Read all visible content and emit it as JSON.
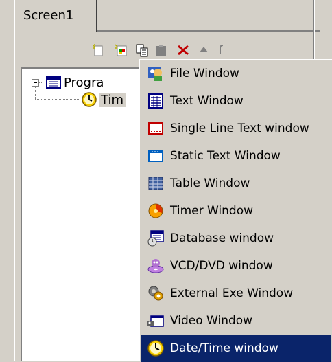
{
  "tabs": [
    {
      "label": "Screen1"
    }
  ],
  "toolbar": {
    "buttons": [
      {
        "icon": "new-item-icon"
      },
      {
        "icon": "add-window-icon"
      },
      {
        "icon": "copy-icon"
      },
      {
        "icon": "paste-icon"
      },
      {
        "icon": "delete-icon"
      },
      {
        "icon": "move-up-icon"
      },
      {
        "icon": "move-down-icon"
      }
    ]
  },
  "tree": {
    "root": {
      "label": "Progra",
      "expanded": true,
      "icon": "program-icon"
    },
    "children": [
      {
        "label": "Tim",
        "icon": "clock-icon",
        "selected": true
      }
    ]
  },
  "menu": {
    "items": [
      {
        "label": "File Window",
        "icon": "file-window-icon"
      },
      {
        "label": "Text Window",
        "icon": "text-window-icon"
      },
      {
        "label": "Single Line Text window",
        "icon": "single-line-text-icon"
      },
      {
        "label": "Static Text Window",
        "icon": "static-text-icon"
      },
      {
        "label": "Table Window",
        "icon": "table-window-icon"
      },
      {
        "label": "Timer Window",
        "icon": "timer-icon"
      },
      {
        "label": "Database window",
        "icon": "database-icon"
      },
      {
        "label": "VCD/DVD window",
        "icon": "vcd-dvd-icon"
      },
      {
        "label": "External Exe Window",
        "icon": "external-exe-icon"
      },
      {
        "label": "Video Window",
        "icon": "video-icon"
      },
      {
        "label": "Date/Time window",
        "icon": "clock-icon",
        "highlighted": true
      }
    ]
  },
  "colors": {
    "face": "#d4d0c8",
    "highlight": "#0a246a",
    "window": "#ffffff"
  }
}
